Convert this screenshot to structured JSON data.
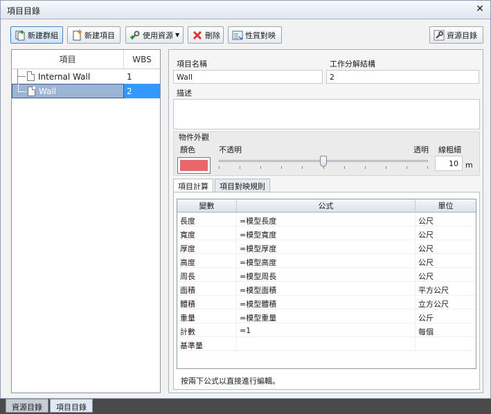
{
  "window": {
    "title": "項目目錄",
    "close_glyph": "✕"
  },
  "toolbar": {
    "new_group": "新建群組",
    "new_item": "新建項目",
    "use_resource": "使用資源",
    "delete": "刪除",
    "property_mapping": "性質對映",
    "resource_catalog": "資源目錄"
  },
  "tree": {
    "col_item": "項目",
    "col_wbs": "WBS",
    "rows": [
      {
        "name": "Internal Wall",
        "wbs": "1"
      },
      {
        "name": "Wall",
        "wbs": "2"
      }
    ]
  },
  "detail": {
    "item_name_label": "項目名稱",
    "item_name_value": "Wall",
    "wbs_label": "工作分解結構",
    "wbs_value": "2",
    "description_label": "描述",
    "description_value": "",
    "appearance": {
      "title": "物件外觀",
      "color_label": "顏色",
      "opaque_label": "不透明",
      "transparent_label": "透明",
      "line_width_label": "線粗細",
      "line_width_value": "10",
      "line_width_unit": "m",
      "color_value": "#e8676b",
      "transparency_fraction": 0.5
    },
    "tabs": [
      "項目計算",
      "項目對映規則"
    ],
    "grid": {
      "headers": [
        "變數",
        "公式",
        "單位"
      ],
      "rows": [
        {
          "var": "長度",
          "formula": "=模型長度",
          "unit": "公尺"
        },
        {
          "var": "寬度",
          "formula": "=模型寬度",
          "unit": "公尺"
        },
        {
          "var": "厚度",
          "formula": "=模型厚度",
          "unit": "公尺"
        },
        {
          "var": "高度",
          "formula": "=模型高度",
          "unit": "公尺"
        },
        {
          "var": "周長",
          "formula": "=模型周長",
          "unit": "公尺"
        },
        {
          "var": "面積",
          "formula": "=模型面積",
          "unit": "平方公尺"
        },
        {
          "var": "體積",
          "formula": "=模型體積",
          "unit": "立方公尺"
        },
        {
          "var": "重量",
          "formula": "=模型重量",
          "unit": "公斤"
        },
        {
          "var": "計數",
          "formula": "=1",
          "unit": "每個"
        },
        {
          "var": "基準量",
          "formula": "",
          "unit": ""
        }
      ]
    },
    "hint": "按兩下公式以直接進行編輯。"
  },
  "bottom_tabs": [
    "資源目錄",
    "項目目錄"
  ]
}
